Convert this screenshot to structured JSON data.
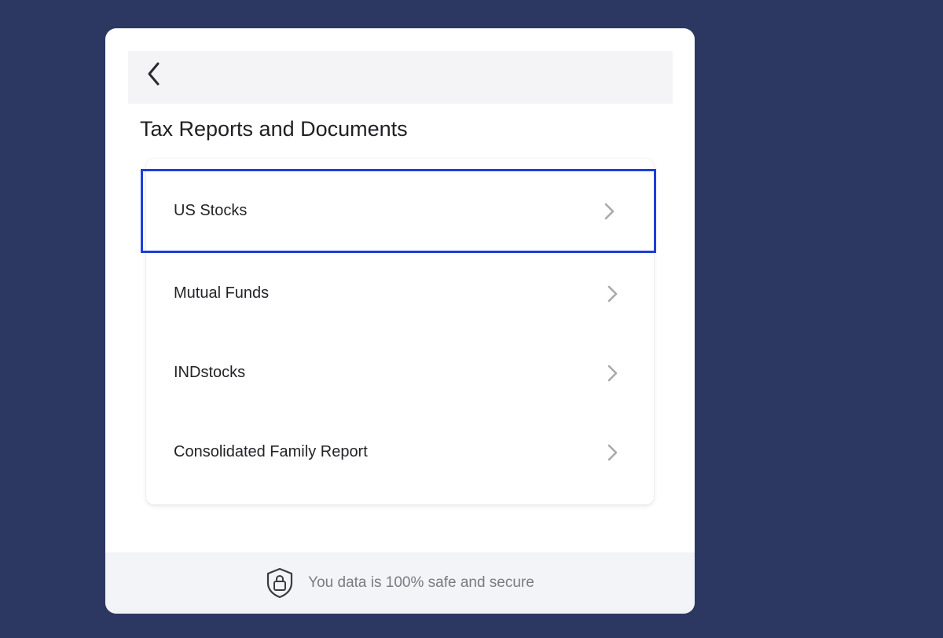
{
  "page": {
    "title": "Tax Reports and Documents"
  },
  "list": {
    "items": [
      {
        "label": "US Stocks",
        "selected": true
      },
      {
        "label": "Mutual Funds",
        "selected": false
      },
      {
        "label": "INDstocks",
        "selected": false
      },
      {
        "label": "Consolidated Family Report",
        "selected": false
      }
    ]
  },
  "footer": {
    "secure_text": "You data is 100% safe and secure"
  },
  "icons": {
    "back": "chevron-left-icon",
    "item_arrow": "chevron-right-icon",
    "secure": "shield-lock-icon"
  },
  "colors": {
    "background": "#2c3862",
    "selection_outline": "#1d3fd8",
    "card": "#ffffff",
    "footer_bg": "#f3f4f7"
  }
}
